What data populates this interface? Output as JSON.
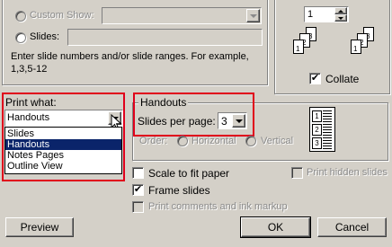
{
  "range": {
    "custom_show_label": "Custom Show:",
    "slides_label": "Slides:",
    "hint": "Enter slide numbers and/or slide ranges. For example, 1,3,5-12"
  },
  "copies": {
    "number_value": "1",
    "collate_label": "Collate",
    "collate_checked": true
  },
  "print_what": {
    "label": "Print what:",
    "selected": "Handouts",
    "options": [
      "Slides",
      "Handouts",
      "Notes Pages",
      "Outline View"
    ],
    "highlighted_option": "Handouts"
  },
  "handouts": {
    "group_title": "Handouts",
    "slides_per_page_label": "Slides per page:",
    "slides_per_page_value": "3",
    "order_label": "Order:",
    "horizontal_label": "Horizontal",
    "vertical_label": "Vertical",
    "preview_numbers": [
      "1",
      "2",
      "3"
    ]
  },
  "options": {
    "scale_to_fit": "Scale to fit paper",
    "frame_slides": "Frame slides",
    "print_comments": "Print comments and ink markup",
    "print_hidden": "Print hidden slides"
  },
  "buttons": {
    "preview": "Preview",
    "ok": "OK",
    "cancel": "Cancel"
  },
  "colors": {
    "dialog_bg": "#d4d0c8",
    "highlight": "#e0001b",
    "selection": "#0a246a"
  }
}
